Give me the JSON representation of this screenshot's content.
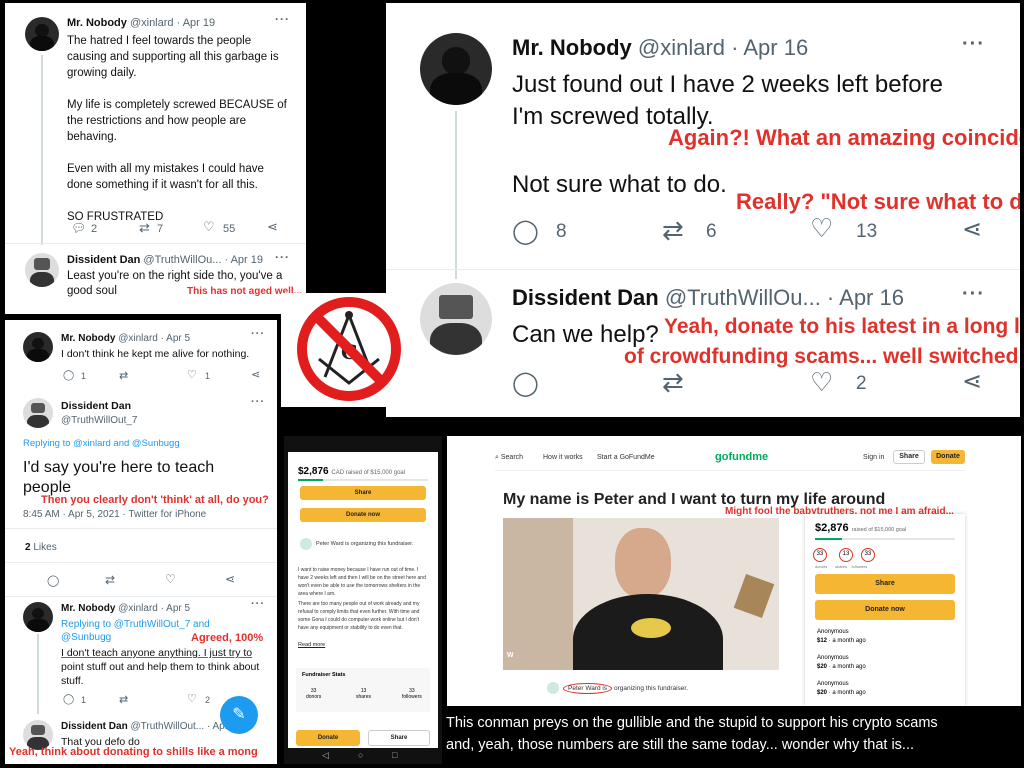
{
  "p1": {
    "name": "Mr. Nobody",
    "handle": "@xinlard · Apr 19",
    "lines": [
      "The hatred I feel towards the people",
      "causing and supporting all this garbage is",
      "growing daily.",
      "",
      "My life is completely screwed BECAUSE of",
      "the restrictions and how people are",
      "behaving.",
      "",
      "Even with all my mistakes I could have",
      "done something if it wasn't for all this.",
      "",
      "SO FRUSTRATED"
    ],
    "replies": "2",
    "retweets": "7",
    "likes": "55",
    "reply_name": "Dissident Dan",
    "reply_handle": "@TruthWillOu... · Apr 19",
    "reply_lines": [
      "Least you're on the right side tho, you've a",
      "good soul"
    ],
    "annotation": "This has not aged well..."
  },
  "p2": {
    "name": "Mr. Nobody",
    "handle": "@xinlard · Apr 16",
    "line1": "Just found out I have 2 weeks left before",
    "line2": "I'm screwed totally.",
    "note1": "Again?! What an amazing coincidence!",
    "line3": "Not sure what to do.",
    "note2": "Really? \"Not sure what to do?\"",
    "replies": "8",
    "retweets": "6",
    "likes": "13",
    "reply_name": "Dissident Dan",
    "reply_handle": "@TruthWillOu... · Apr 16",
    "reply_text": "Can we help?",
    "note3a": "Yeah, donate to his latest in a long line",
    "note3b": "of crowdfunding scams... well switched on...",
    "reply_likes": "2"
  },
  "p3": {
    "name1": "Mr. Nobody",
    "handle1": "@xinlard · Apr 5",
    "text1": "I don't think he kept me alive for nothing.",
    "c1_replies": "1",
    "c1_likes": "1",
    "name2": "Dissident Dan",
    "handle2": "@TruthWillOut_7",
    "replying": "Replying to @xinlard and @Sunbugg",
    "big1": "I'd say you're here to teach",
    "big2": "people",
    "note1": "Then you clearly don't 'think' at all, do you?",
    "meta": "8:45 AM · Apr 5, 2021 · Twitter for iPhone",
    "likes_count": "2",
    "likes_label": "Likes",
    "name3": "Mr. Nobody",
    "handle3": "@xinlard · Apr 5",
    "replying3a": "Replying to @TruthWillOut_7 and",
    "replying3b": "@Sunbugg",
    "note2": "Agreed, 100%",
    "t3": [
      "I don't teach anyone anything. I just try to",
      "point stuff out and help them to think about",
      "stuff."
    ],
    "c3_replies": "1",
    "c3_likes": "2",
    "name4": "Dissident Dan",
    "handle4": "@TruthWillOut... · Apr",
    "text4": "That you defo do",
    "note3": "Yeah, think about donating to shills like a mong"
  },
  "p5": {
    "amount": "$2,876",
    "goal": "CAD raised of $15,000 goal",
    "share": "Share",
    "donate": "Donate now",
    "organizer": "Peter Ward is organizing this fundraiser.",
    "para1": "I want to raise money because I have run out of time. I have 2 weeks left and then I will be on the street here and won't even be able to use the tomorrows shelters in the area where I am.",
    "para2": "There are too many people out of work already and my refusal to comply limits that even further. With time and some Gona I could do computer work online but I don't have any equipment or stability to do even that.",
    "read_more": "Read more",
    "stats_title": "Fundraiser Stats",
    "stats": [
      {
        "n": "33",
        "l": "donors"
      },
      {
        "n": "13",
        "l": "shares"
      },
      {
        "n": "33",
        "l": "followers"
      }
    ],
    "donate_btn": "Donate",
    "share_btn": "Share"
  },
  "p6": {
    "search": "Search",
    "how": "How it works",
    "start": "Start a GoFundMe",
    "logo": "gofundme",
    "signin": "Sign in",
    "share": "Share",
    "donate": "Donate",
    "title": "My name is Peter and I want to turn my life around",
    "note1": "Might fool the babytruthers, not me I am afraid...",
    "amount": "$2,876",
    "goal": "raised of $15,000 goal",
    "stats": [
      {
        "n": "33",
        "l": "donors"
      },
      {
        "n": "13",
        "l": "shares"
      },
      {
        "n": "33",
        "l": "followers"
      }
    ],
    "share_btn": "Share",
    "donate_btn": "Donate now",
    "donors": [
      {
        "name": "Anonymous",
        "amount": "$12",
        "when": "a month ago"
      },
      {
        "name": "Anonymous",
        "amount": "$20",
        "when": "a month ago"
      },
      {
        "name": "Anonymous",
        "amount": "$20",
        "when": "a month ago"
      }
    ],
    "organizer_name": "Peter Ward is",
    "organizer_rest": "organizing this fundraiser.",
    "video_label": "W"
  },
  "caption": {
    "line1": "This conman preys on the gullible and the stupid to support his crypto scams",
    "line2": "and, yeah, those numbers are still the same today... wonder why that is..."
  },
  "colors": {
    "annotation": "#e0312b",
    "gofundme_green": "#02a95c",
    "gofundme_yellow": "#f5b633"
  }
}
